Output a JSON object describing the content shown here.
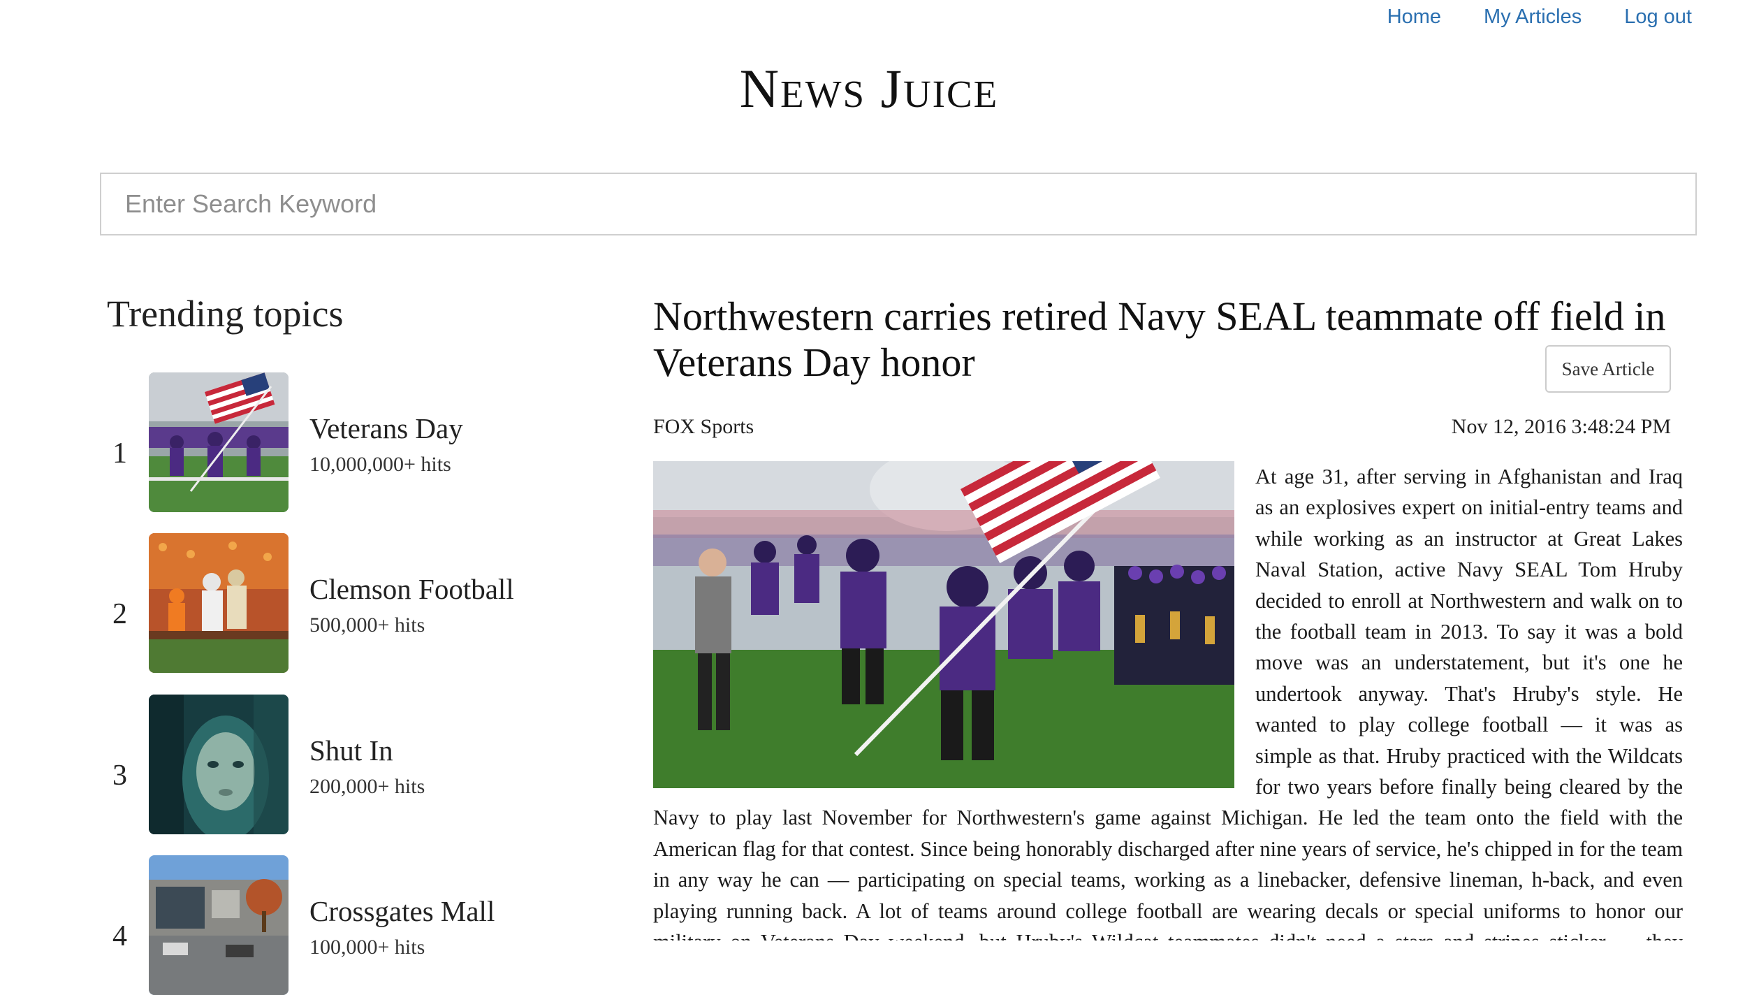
{
  "nav": {
    "home": "Home",
    "my_articles": "My Articles",
    "logout": "Log out"
  },
  "brand": "News Juice",
  "search": {
    "placeholder": "Enter Search Keyword",
    "value": ""
  },
  "trending": {
    "title": "Trending topics",
    "items": [
      {
        "rank": "1",
        "name": "Veterans Day",
        "hits": "10,000,000+ hits"
      },
      {
        "rank": "2",
        "name": "Clemson Football",
        "hits": "500,000+ hits"
      },
      {
        "rank": "3",
        "name": "Shut In",
        "hits": "200,000+ hits"
      },
      {
        "rank": "4",
        "name": "Crossgates Mall",
        "hits": "100,000+ hits"
      }
    ]
  },
  "article": {
    "headline": "Northwestern carries retired Navy SEAL teammate off field in Veterans Day honor",
    "save_label": "Save Article",
    "source": "FOX Sports",
    "date": "Nov 12, 2016 3:48:24 PM",
    "body": "At age 31, after serving in Afghanistan and Iraq as an explosives expert on initial-entry teams and while working as an instructor at Great Lakes Naval Station, active Navy SEAL Tom Hruby decided to enroll at Northwestern and walk on to the football team in 2013. To say it was a bold move was an understatement, but it's one he undertook anyway. That's Hruby's style. He wanted to play college football — it was as simple as that. Hruby practiced with the Wildcats for two years before finally being cleared by the Navy to play last November for Northwestern's game against Michigan. He led the team onto the field with the American flag for that contest. Since being honorably discharged after nine years of service, he's chipped in for the team in any way he can — participating on special teams, working as a linebacker, defensive lineman, h-back, and even playing running back. A lot of teams around college football are wearing decals or special uniforms to honor our military on Veterans Day weekend, but Hruby's Wildcat teammates didn't need a stars and stripes sticker — they honored \"an American hero\" —"
  },
  "colors": {
    "link": "#2a6fb0",
    "purple_uniform": "#4b2a82",
    "border": "#cfcfcf"
  }
}
